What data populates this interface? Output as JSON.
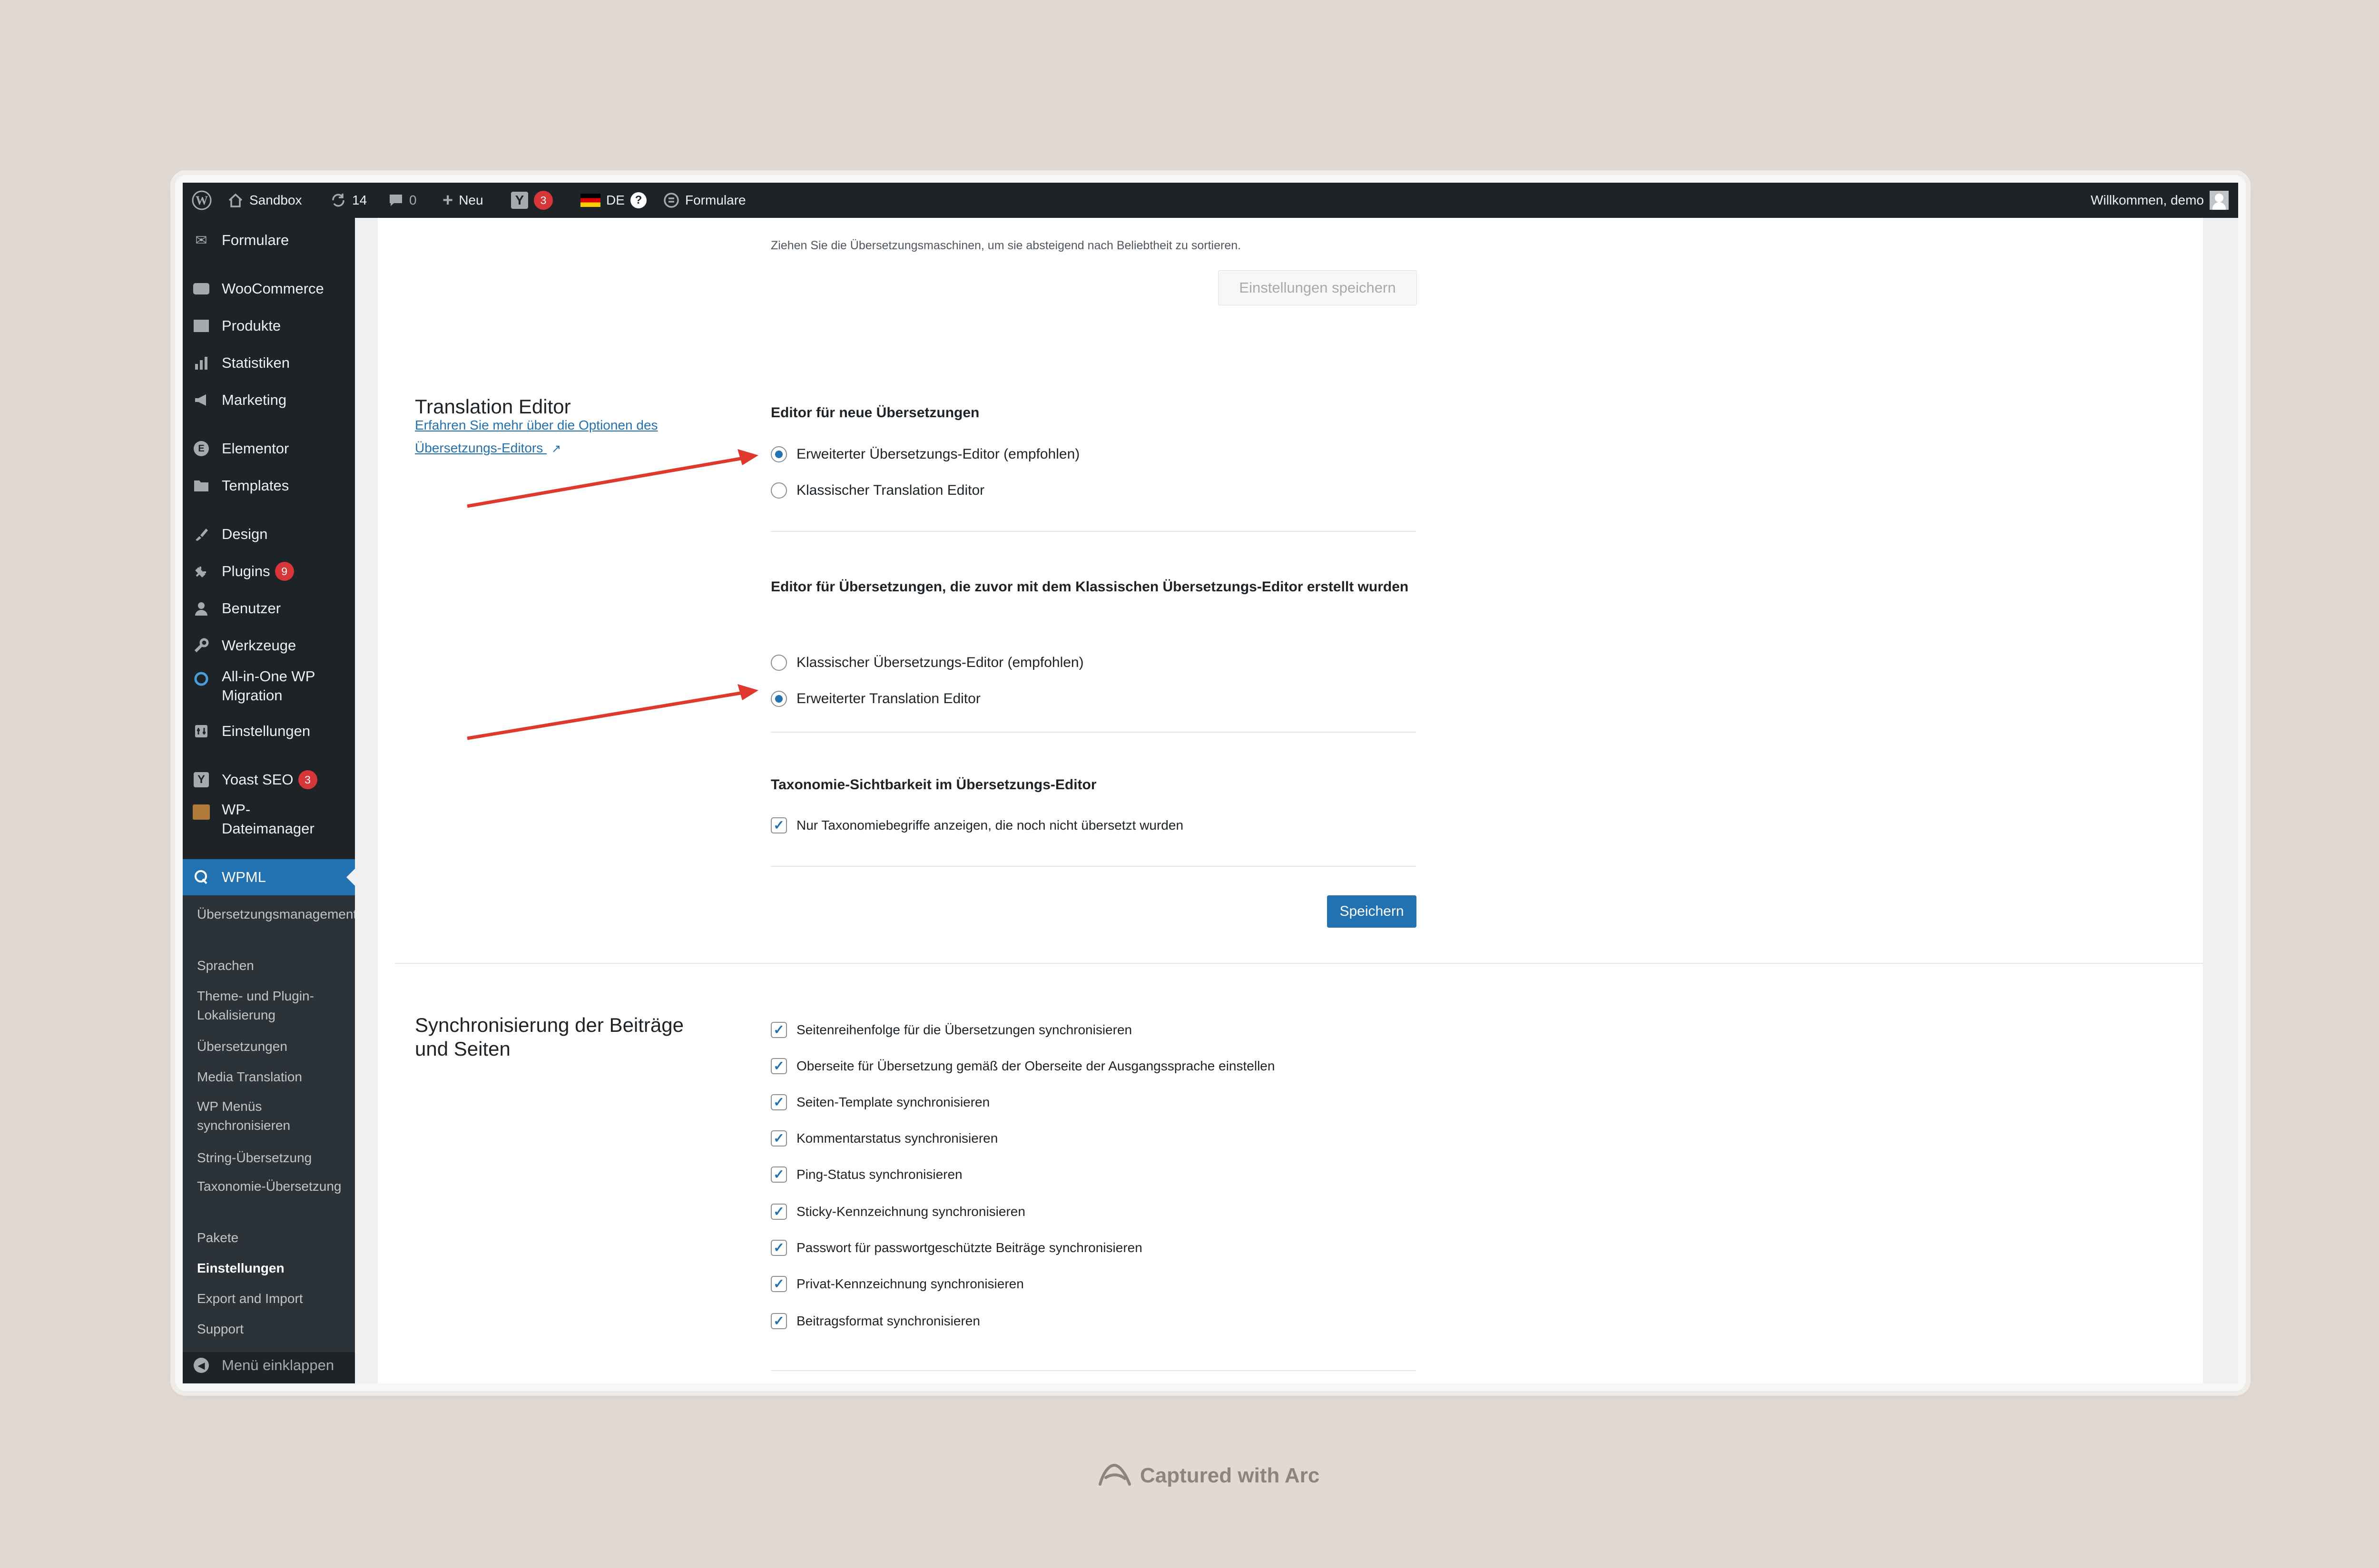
{
  "adminbar": {
    "site_name": "Sandbox",
    "updates_count": "14",
    "comments_count": "0",
    "new_label": "Neu",
    "yoast_count": "3",
    "language_code": "DE",
    "help_glyph": "?",
    "formulare_label": "Formulare",
    "welcome": "Willkommen, demo"
  },
  "sidebar": {
    "items": [
      {
        "label": "Formulare",
        "icon": "mail-icon"
      },
      {
        "label": "WooCommerce",
        "icon": "woo-icon"
      },
      {
        "label": "Produkte",
        "icon": "archive-icon"
      },
      {
        "label": "Statistiken",
        "icon": "bar-chart-icon"
      },
      {
        "label": "Marketing",
        "icon": "megaphone-icon"
      },
      {
        "label": "Elementor",
        "icon": "elementor-icon"
      },
      {
        "label": "Templates",
        "icon": "folder-icon"
      },
      {
        "label": "Design",
        "icon": "brush-icon"
      },
      {
        "label": "Plugins",
        "icon": "plugin-icon",
        "badge": "9"
      },
      {
        "label": "Benutzer",
        "icon": "user-icon"
      },
      {
        "label": "Werkzeuge",
        "icon": "wrench-icon"
      },
      {
        "label": "All-in-One WP Migration",
        "icon": "migration-icon"
      },
      {
        "label": "Einstellungen",
        "icon": "settings-icon"
      },
      {
        "label": "Yoast SEO",
        "icon": "yoast-icon",
        "badge": "3"
      },
      {
        "label": "WP-Dateimanager",
        "icon": "file-manager-icon"
      },
      {
        "label": "WPML",
        "icon": "wpml-icon"
      }
    ],
    "submenu": [
      "Übersetzungsmanagement",
      "Sprachen",
      "Theme- und Plugin-Lokalisierung",
      "Übersetzungen",
      "Media Translation",
      "WP Menüs synchronisieren",
      "String-Übersetzung",
      "Taxonomie-Übersetzung",
      "Pakete",
      "Einstellungen",
      "Export and Import",
      "Support"
    ],
    "collapse_label": "Menü einklappen"
  },
  "main": {
    "engines_help": "Ziehen Sie die Übersetzungsmaschinen, um sie absteigend nach Beliebtheit zu sortieren.",
    "save_engines_label": "Einstellungen speichern",
    "translation_editor": {
      "title": "Translation Editor",
      "link": "Erfahren Sie mehr über die Optionen des Übersetzungs-Editors",
      "new_translations_label": "Editor für neue Übersetzungen",
      "new_options": [
        "Erweiterter Übersetzungs-Editor (empfohlen)",
        "Klassischer Translation Editor"
      ],
      "new_selected": 0,
      "legacy_label": "Editor für Übersetzungen, die zuvor mit dem Klassischen Übersetzungs-Editor erstellt wurden",
      "legacy_options": [
        "Klassischer Übersetzungs-Editor (empfohlen)",
        "Erweiterter Translation Editor"
      ],
      "legacy_selected": 1,
      "taxonomy_label": "Taxonomie-Sichtbarkeit im Übersetzungs-Editor",
      "taxonomy_checkbox": "Nur Taxonomiebegriffe anzeigen, die noch nicht übersetzt wurden",
      "save_label": "Speichern"
    },
    "sync": {
      "title": "Synchronisierung der Beiträge und Seiten",
      "options": [
        "Seitenreihenfolge für die Übersetzungen synchronisieren",
        "Oberseite für Übersetzung gemäß der Oberseite der Ausgangssprache einstellen",
        "Seiten-Template synchronisieren",
        "Kommentarstatus synchronisieren",
        "Ping-Status synchronisieren",
        "Sticky-Kennzeichnung synchronisieren",
        "Passwort für passwortgeschützte Beiträge synchronisieren",
        "Privat-Kennzeichnung synchronisieren",
        "Beitragsformat synchronisieren"
      ]
    }
  },
  "footer": {
    "captured_with": "Captured with Arc"
  },
  "colors": {
    "accent": "#2271b1",
    "admin_dark": "#1d2327",
    "badge_red": "#d63638",
    "annotation_arrow": "#e0382c"
  }
}
